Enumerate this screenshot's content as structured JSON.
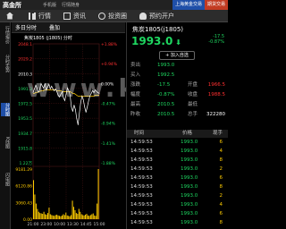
{
  "topbar": {
    "logo": "高金所",
    "link1": "手机版",
    "link2": "行情随身",
    "tab1": "上海黄金交易",
    "tab2": "期货交易"
  },
  "nav": {
    "items": [
      {
        "label": "行情",
        "icon": "home-icon"
      },
      {
        "label": "行情",
        "icon": "bars-icon"
      },
      {
        "label": "资讯",
        "icon": "news-icon"
      },
      {
        "label": "投资圈",
        "icon": "clock-icon"
      },
      {
        "label": "预约开户",
        "icon": "user-icon"
      }
    ]
  },
  "sidebar": {
    "items": [
      "行情报价",
      "分时走势",
      "分时图",
      "K线图",
      "闪电图"
    ]
  },
  "chart": {
    "period": "多日分时",
    "add": "叠加",
    "legend": "焦炭1805 (j1805) 分时",
    "watermark": "www.ke"
  },
  "chart_data": [
    {
      "type": "line",
      "x_ticks": [
        "21:00",
        "23:00",
        "10:00",
        "13:30",
        "14:45",
        "15:00"
      ],
      "y_left": [
        "2048.1",
        "2029.2",
        "2010.3",
        "1991.3",
        "1972.5",
        "1953.5",
        "1934.7",
        "1915.8",
        "1.22万"
      ],
      "y_right": [
        "+1.88%",
        "+0.94%",
        "0.00%",
        "-0.47%",
        "-0.94%",
        "-1.41%",
        "-1.88%"
      ],
      "ylim": [
        1915.8,
        2048.1
      ],
      "series": [
        {
          "x": [
            0,
            2,
            4,
            6,
            8,
            10,
            12,
            14,
            16,
            18,
            20,
            22,
            24,
            26,
            28,
            30,
            32,
            34,
            36,
            38,
            40,
            42,
            44,
            46,
            48,
            50,
            52,
            54,
            56,
            58,
            60,
            62,
            64,
            66,
            68,
            70,
            72,
            74,
            76,
            78,
            80,
            82,
            84,
            86,
            88,
            90,
            92,
            94,
            96,
            98,
            100
          ],
          "values": [
            1994,
            1998,
            2002,
            1999,
            1994,
            1997,
            2004,
            2001,
            1999,
            2004,
            1997,
            2000,
            2003,
            1998,
            2001,
            1998,
            1996,
            1998,
            1995,
            1991,
            1989,
            1992,
            1995,
            1988,
            1985,
            1992,
            1999,
            1996,
            1991,
            1978,
            1973,
            1980,
            1975,
            1965,
            1958,
            1971,
            1983,
            1990,
            1986,
            1978,
            1972,
            1978,
            1985,
            1990,
            1993,
            1996,
            1994,
            1997,
            1995,
            1994,
            1993
          ]
        },
        {
          "values": [
            1993,
            1993,
            1994,
            1994,
            1995,
            1995,
            1996,
            1996,
            1996,
            1997,
            1997,
            1997,
            1997,
            1997,
            1997,
            1997,
            1997,
            1997,
            1996,
            1996,
            1996,
            1996,
            1995,
            1995,
            1995,
            1995,
            1995,
            1995,
            1995,
            1994,
            1993,
            1993,
            1992,
            1991,
            1990,
            1990,
            1990,
            1990,
            1990,
            1990,
            1990,
            1990,
            1990,
            1990,
            1990,
            1990,
            1990,
            1991,
            1991,
            1991,
            1991
          ]
        }
      ]
    },
    {
      "type": "bar",
      "ylabels": [
        "9181.29",
        "6120.86",
        "3060.43",
        "0.00"
      ],
      "ylim": [
        0,
        12200
      ],
      "values": [
        9500,
        6000,
        3800,
        2500,
        1800,
        1500,
        1400,
        1300,
        1800,
        1200,
        1100,
        1500,
        2800,
        1200,
        1000,
        900,
        800,
        1000,
        1100,
        900,
        800,
        700,
        900,
        1200,
        1000,
        1600,
        900,
        800,
        700,
        1000,
        4500,
        3000,
        2200,
        1500,
        1300,
        2500,
        1800,
        1200,
        1000,
        900,
        1100,
        1300,
        900,
        800,
        1000,
        1200,
        1400,
        900,
        800,
        3800,
        12200
      ]
    }
  ],
  "quote": {
    "symbol": "焦炭1805(j1805)",
    "price": "1993.0",
    "change": "-17.5",
    "change_pct": "-0.87%",
    "add_fav": "+ 加入自选",
    "rows": [
      {
        "k": "卖出",
        "v": "1993.0",
        "k2": "",
        "v2": "",
        "c2": "white"
      },
      {
        "k": "买入",
        "v": "1992.5",
        "k2": "",
        "v2": "",
        "c2": "white"
      },
      {
        "k": "涨跌",
        "v": "-17.5",
        "k2": "开盘",
        "v2": "1966.5",
        "c2": "red"
      },
      {
        "k": "幅度",
        "v": "-0.87%",
        "k2": "收盘",
        "v2": "1988.5",
        "c2": "red"
      },
      {
        "k": "最高",
        "v": "2010.5",
        "k2": "最低",
        "v2": "",
        "c2": "white"
      },
      {
        "k": "昨收",
        "v": "2010.5",
        "k2": "总手",
        "v2": "322280",
        "c2": "white"
      }
    ]
  },
  "trades": {
    "headers": {
      "time": "时间",
      "price": "价格",
      "vol": "现手"
    },
    "rows": [
      {
        "time": "14:59:53",
        "price": "1993.0",
        "vol": "6"
      },
      {
        "time": "14:59:53",
        "price": "1993.0",
        "vol": "4"
      },
      {
        "time": "14:59:53",
        "price": "1993.0",
        "vol": "8"
      },
      {
        "time": "14:59:53",
        "price": "1993.0",
        "vol": "2"
      },
      {
        "time": "14:59:53",
        "price": "1993.0",
        "vol": "6"
      },
      {
        "time": "14:59:53",
        "price": "1993.0",
        "vol": "8"
      },
      {
        "time": "14:59:53",
        "price": "1993.0",
        "vol": "2"
      },
      {
        "time": "14:59:53",
        "price": "1993.0",
        "vol": "4"
      },
      {
        "time": "14:59:53",
        "price": "1993.0",
        "vol": "6"
      },
      {
        "time": "14:59:53",
        "price": "1993.0",
        "vol": "8"
      }
    ]
  }
}
